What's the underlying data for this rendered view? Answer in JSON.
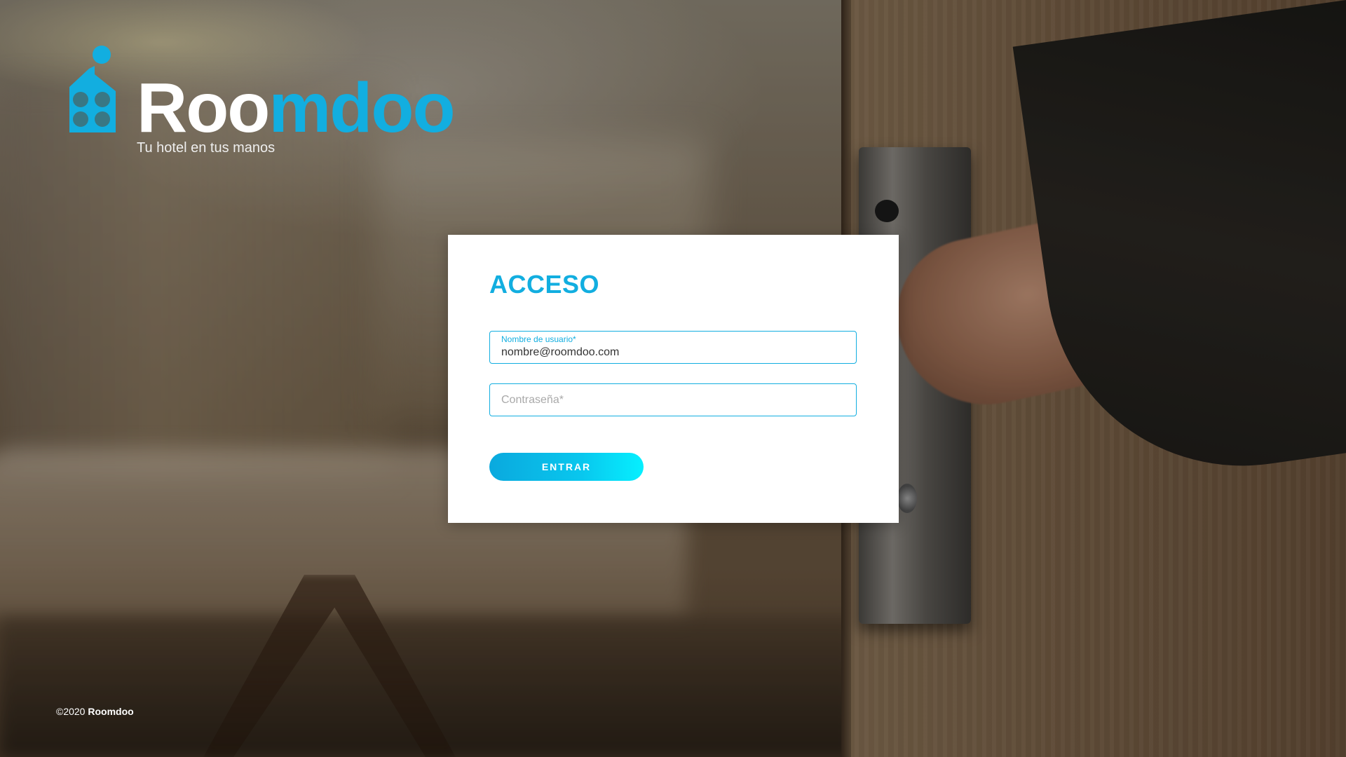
{
  "brand": {
    "name_part1": "Roo",
    "name_part2": "mdoo",
    "tagline": "Tu hotel en tus manos"
  },
  "login": {
    "title": "ACCESO",
    "username": {
      "label": "Nombre de usuario*",
      "value": "nombre@roomdoo.com"
    },
    "password": {
      "placeholder": "Contraseña*",
      "value": ""
    },
    "submit_label": "ENTRAR"
  },
  "footer": {
    "copyright": "©2020",
    "brand": "Roomdoo"
  },
  "colors": {
    "accent": "#12aee0",
    "card_background": "#ffffff",
    "button_gradient_start": "#0aa9de",
    "button_gradient_end": "#06f0ff"
  }
}
